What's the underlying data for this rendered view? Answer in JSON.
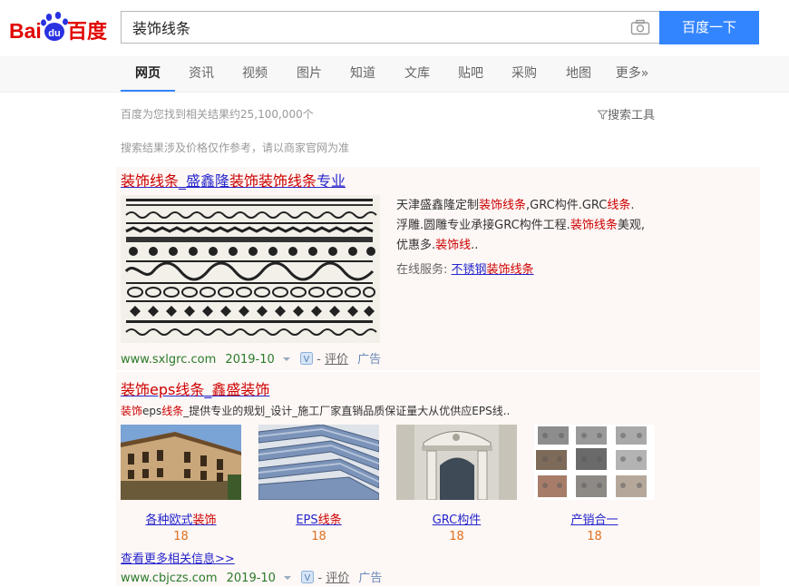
{
  "logo": {
    "text_left": "Bai",
    "text_paw": "du",
    "text_right": "百度"
  },
  "search": {
    "query": "装饰线条",
    "button_label": "百度一下"
  },
  "tabs": [
    "网页",
    "资讯",
    "视频",
    "图片",
    "知道",
    "文库",
    "贴吧",
    "采购",
    "地图",
    "更多»"
  ],
  "stats": {
    "count_text": "百度为您找到相关结果约25,100,000个",
    "tools_label": "搜索工具",
    "notice": "搜索结果涉及价格仅作参考，请以商家官网为准"
  },
  "result1": {
    "title_parts": [
      "装饰线条",
      "_盛鑫隆",
      "装饰装饰线条",
      "专业"
    ],
    "desc_parts": [
      "天津盛鑫隆定制",
      "装饰线条",
      ",GRC构件.GRC",
      "线条",
      ".浮雕.圆雕专业承接GRC构件工程.",
      "装饰线条",
      "美观,优惠多.",
      "装饰线",
      ".."
    ],
    "service_label": "在线服务:",
    "service_link_parts": [
      "不锈钢",
      "装饰线条"
    ],
    "url": "www.sxlgrc.com",
    "date": "2019-10",
    "eval": "评价",
    "ad": "广告"
  },
  "result2": {
    "title_parts": [
      "装饰eps线条",
      "_",
      "鑫盛装饰"
    ],
    "desc_parts": [
      "装饰",
      "eps",
      "线条",
      "_提供专业的规划_设计_施工厂家直销品质保证量大从优供应EPS线.."
    ],
    "images": [
      {
        "caption_parts": [
          "各种欧式",
          "装饰"
        ],
        "count": "18"
      },
      {
        "caption_parts": [
          "EPS",
          "线条"
        ],
        "count": "18"
      },
      {
        "caption_parts": [
          "GRC构件"
        ],
        "count": "18"
      },
      {
        "caption_parts": [
          "产销合一"
        ],
        "count": "18"
      }
    ],
    "more_label": "查看更多相关信息>>",
    "url": "www.cbjczs.com",
    "date": "2019-10",
    "eval": "评价",
    "ad": "广告"
  },
  "colors": {
    "accent": "#3385ff",
    "title_link": "#2626cc",
    "highlight": "#cc0000",
    "url_green": "#2a7a2a",
    "ad_bg": "#fdf7f5"
  },
  "icons": [
    "paw-icon",
    "camera-icon",
    "filter-icon",
    "dropdown-arrow-icon",
    "verify-v-icon"
  ]
}
